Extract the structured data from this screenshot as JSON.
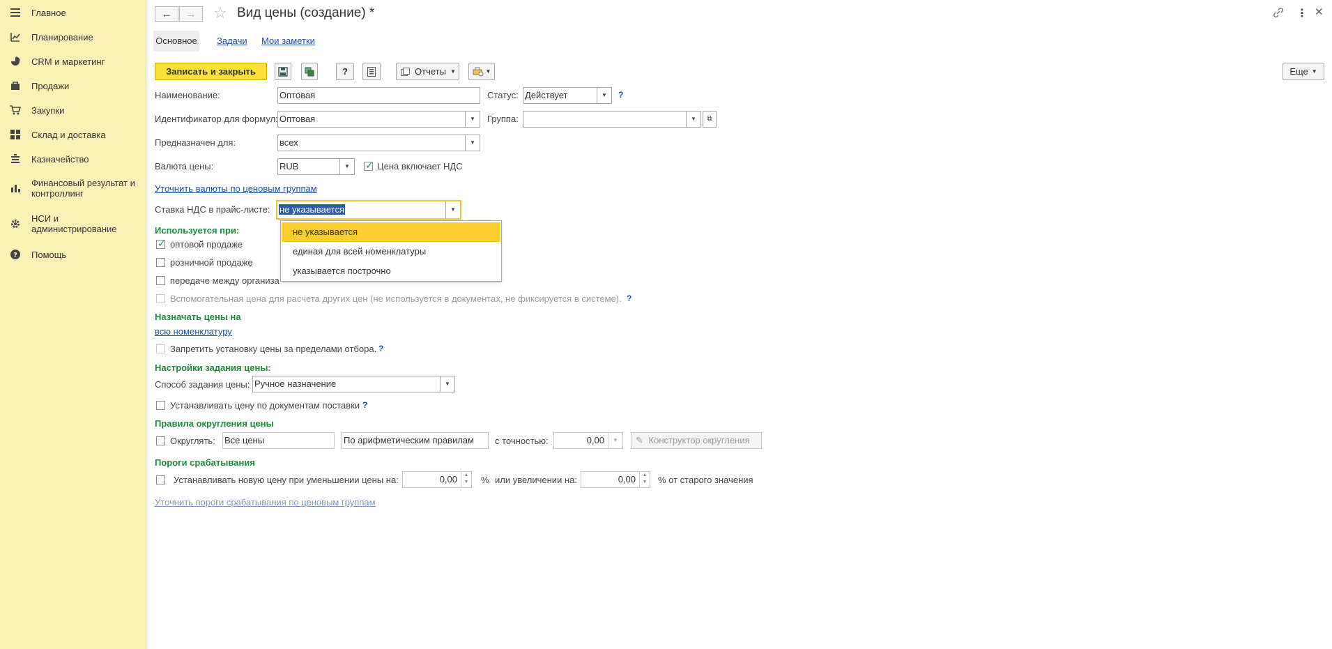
{
  "sidebar": {
    "items": [
      {
        "label": "Главное",
        "icon": "menu-icon"
      },
      {
        "label": "Планирование",
        "icon": "planning-icon"
      },
      {
        "label": "CRM и маркетинг",
        "icon": "crm-icon"
      },
      {
        "label": "Продажи",
        "icon": "bag-icon"
      },
      {
        "label": "Закупки",
        "icon": "cart-icon"
      },
      {
        "label": "Склад и доставка",
        "icon": "warehouse-icon"
      },
      {
        "label": "Казначейство",
        "icon": "treasury-icon"
      },
      {
        "label": "Финансовый результат и контроллинг",
        "icon": "chart-icon"
      },
      {
        "label": "НСИ и администрирование",
        "icon": "gear-icon"
      },
      {
        "label": "Помощь",
        "icon": "help-icon"
      }
    ]
  },
  "header": {
    "title": "Вид цены (создание) *"
  },
  "tabs": [
    {
      "label": "Основное"
    },
    {
      "label": "Задачи"
    },
    {
      "label": "Мои заметки"
    }
  ],
  "toolbar": {
    "save_close": "Записать и закрыть",
    "help": "?",
    "reports": "Отчеты",
    "more": "Еще"
  },
  "form": {
    "name_label": "Наименование:",
    "name_value": "Оптовая",
    "status_label": "Статус:",
    "status_value": "Действует",
    "formula_id_label": "Идентификатор для формул:",
    "formula_id_value": "Оптовая",
    "group_label": "Группа:",
    "group_value": "",
    "intended_label": "Предназначен для:",
    "intended_value": "всех",
    "currency_label": "Валюта цены:",
    "currency_value": "RUB",
    "vat_included_label": "Цена включает НДС",
    "specify_currency_link": "Уточнить валюты по ценовым группам",
    "vat_rate_label": "Ставка НДС в прайс-листе:",
    "vat_rate_value": "не указывается",
    "used_section": "Используется при:",
    "used_wholesale": "оптовой продаже",
    "used_retail": "розничной продаже",
    "used_transfer": "передаче между организа",
    "auxiliary": "Вспомогательная цена для расчета других цен (не используется в документах, не фиксируется в системе).",
    "assign_section": "Назначать цены на",
    "assign_link": "всю номенклатуру",
    "forbid_label": "Запретить установку цены за пределами отбора.",
    "settings_section": "Настройки задания цены:",
    "method_label": "Способ задания цены:",
    "method_value": "Ручное назначение",
    "by_supply_label": "Устанавливать цену по документам поставки",
    "rounding_section": "Правила округления цены",
    "round_label": "Округлять:",
    "round_all": "Все цены",
    "round_rule": "По арифметическим правилам",
    "precision_label": "с точностью:",
    "precision_value": "0,00",
    "round_constructor": "Конструктор округления",
    "thresholds_section": "Пороги срабатывания",
    "threshold_label": "Устанавливать новую цену при уменьшении цены на:",
    "decrease_value": "0,00",
    "percent": "%",
    "increase_label": "или увеличении на:",
    "increase_value": "0,00",
    "percent_old": "% от старого значения",
    "thresholds_link": "Уточнить пороги срабатывания по ценовым группам"
  },
  "dropdown": {
    "options": [
      "не указывается",
      "единая для всей номенклатуры",
      "указывается построчно"
    ]
  },
  "colors": {
    "sidebar_bg": "#fbf0b6",
    "primary_button": "#fce13a",
    "section_green": "#1e8a3b",
    "link_blue": "#1f4ea3",
    "dropdown_selected": "#fbcd2f"
  }
}
